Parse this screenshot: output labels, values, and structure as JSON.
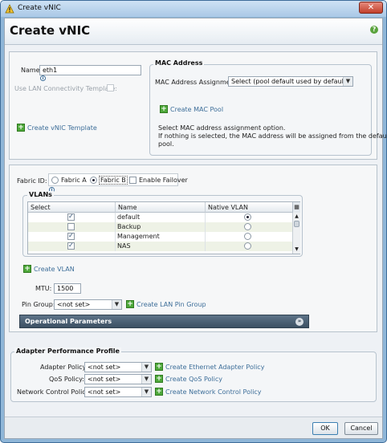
{
  "window": {
    "title": "Create vNIC",
    "close_symbol": "✕"
  },
  "header": {
    "title": "Create vNIC",
    "help_symbol": "?"
  },
  "identity": {
    "name_label": "Name:",
    "name_value": "eth1",
    "use_template_label": "Use LAN Connectivity Template:",
    "create_template_link": "Create vNIC Template"
  },
  "mac": {
    "legend": "MAC Address",
    "assignment_label": "MAC Address Assignment:",
    "assignment_value": "Select (pool default used by default)",
    "create_pool_link": "Create MAC Pool",
    "help_line1": "Select MAC address assignment option.",
    "help_line2": "If nothing is selected, the MAC address will be assigned from the default",
    "help_line3": "pool."
  },
  "fabric": {
    "label": "Fabric ID:",
    "option_a": "Fabric A",
    "option_b": "Fabric B",
    "selected": "Fabric B",
    "failover_label": "Enable Failover"
  },
  "vlans": {
    "legend": "VLANs",
    "columns": [
      "Select",
      "Name",
      "Native VLAN"
    ],
    "rows": [
      {
        "name": "default",
        "selected": true,
        "native": true
      },
      {
        "name": "Backup",
        "selected": false,
        "native": false
      },
      {
        "name": "Management",
        "selected": true,
        "native": false
      },
      {
        "name": "NAS",
        "selected": true,
        "native": false
      }
    ],
    "create_link": "Create VLAN"
  },
  "mtu": {
    "label": "MTU:",
    "value": "1500"
  },
  "pin_group": {
    "label": "Pin Group:",
    "value": "<not set>",
    "create_link": "Create LAN Pin Group"
  },
  "operational": {
    "title": "Operational Parameters"
  },
  "adapter": {
    "legend": "Adapter Performance Profile",
    "policies": [
      {
        "label": "Adapter Policy:",
        "value": "<not set>",
        "link": "Create Ethernet Adapter Policy"
      },
      {
        "label": "QoS Policy:",
        "value": "<not set>",
        "link": "Create QoS Policy"
      },
      {
        "label": "Network Control Policy:",
        "value": "<not set>",
        "link": "Create Network Control Policy"
      }
    ]
  },
  "footer": {
    "ok_label": "OK",
    "cancel_label": "Cancel"
  },
  "colors": {
    "title_bar": "#a9c8e6",
    "accent_green": "#4ea83a",
    "link_blue": "#3d6e99",
    "ops_bar": "#4a5f73"
  }
}
